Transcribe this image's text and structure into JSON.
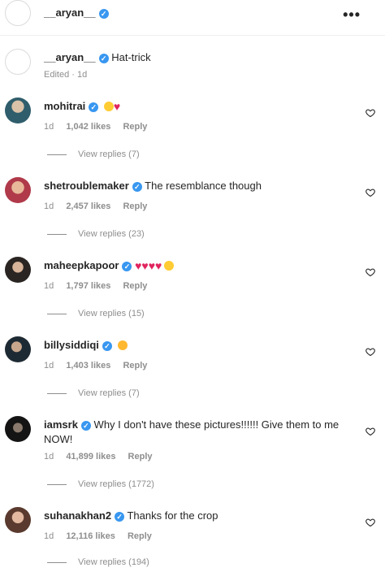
{
  "post": {
    "author": "__aryan__",
    "more_label": "•••",
    "caption": "Hat-trick",
    "caption_meta": "Edited · 1d"
  },
  "comments": [
    {
      "user": "mohitrai",
      "text": "",
      "emojis": "face-heart-eyes, red-heart",
      "time": "1d",
      "likes": "1,042 likes",
      "reply": "Reply",
      "view": "View replies (7)"
    },
    {
      "user": "shetroublemaker",
      "text": "The resemblance though",
      "time": "1d",
      "likes": "2,457 likes",
      "reply": "Reply",
      "view": "View replies (23)"
    },
    {
      "user": "maheepkapoor",
      "text": "",
      "emojis": "red-heart x4, face-heart-eyes",
      "time": "1d",
      "likes": "1,797 likes",
      "reply": "Reply",
      "view": "View replies (15)"
    },
    {
      "user": "billysiddiqi",
      "text": "",
      "emojis": "party-face",
      "time": "1d",
      "likes": "1,403 likes",
      "reply": "Reply",
      "view": "View replies (7)"
    },
    {
      "user": "iamsrk",
      "text": "Why I don't have these pictures!!!!!! Give them to me NOW!",
      "time": "1d",
      "likes": "41,899 likes",
      "reply": "Reply",
      "view": "View replies (1772)"
    },
    {
      "user": "suhanakhan2",
      "text": "Thanks for the crop",
      "time": "1d",
      "likes": "12,116 likes",
      "reply": "Reply",
      "view": "View replies (194)"
    }
  ],
  "colors": {
    "verified": "#3897f0",
    "muted": "#8e8e8e",
    "text": "#262626",
    "heart_emoji": "#e0245e"
  },
  "icons": {
    "verified": "verified-badge-icon",
    "like": "heart-outline-icon",
    "more": "more-options-icon"
  }
}
